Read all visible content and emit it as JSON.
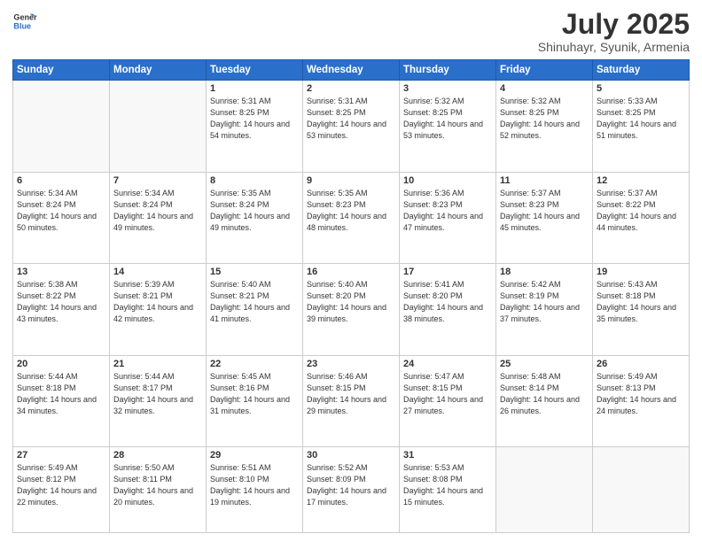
{
  "logo": {
    "line1": "General",
    "line2": "Blue"
  },
  "header": {
    "month": "July 2025",
    "location": "Shinuhayr, Syunik, Armenia"
  },
  "weekdays": [
    "Sunday",
    "Monday",
    "Tuesday",
    "Wednesday",
    "Thursday",
    "Friday",
    "Saturday"
  ],
  "weeks": [
    [
      {
        "day": "",
        "empty": true
      },
      {
        "day": "",
        "empty": true
      },
      {
        "day": "1",
        "sunrise": "Sunrise: 5:31 AM",
        "sunset": "Sunset: 8:25 PM",
        "daylight": "Daylight: 14 hours and 54 minutes."
      },
      {
        "day": "2",
        "sunrise": "Sunrise: 5:31 AM",
        "sunset": "Sunset: 8:25 PM",
        "daylight": "Daylight: 14 hours and 53 minutes."
      },
      {
        "day": "3",
        "sunrise": "Sunrise: 5:32 AM",
        "sunset": "Sunset: 8:25 PM",
        "daylight": "Daylight: 14 hours and 53 minutes."
      },
      {
        "day": "4",
        "sunrise": "Sunrise: 5:32 AM",
        "sunset": "Sunset: 8:25 PM",
        "daylight": "Daylight: 14 hours and 52 minutes."
      },
      {
        "day": "5",
        "sunrise": "Sunrise: 5:33 AM",
        "sunset": "Sunset: 8:25 PM",
        "daylight": "Daylight: 14 hours and 51 minutes."
      }
    ],
    [
      {
        "day": "6",
        "sunrise": "Sunrise: 5:34 AM",
        "sunset": "Sunset: 8:24 PM",
        "daylight": "Daylight: 14 hours and 50 minutes."
      },
      {
        "day": "7",
        "sunrise": "Sunrise: 5:34 AM",
        "sunset": "Sunset: 8:24 PM",
        "daylight": "Daylight: 14 hours and 49 minutes."
      },
      {
        "day": "8",
        "sunrise": "Sunrise: 5:35 AM",
        "sunset": "Sunset: 8:24 PM",
        "daylight": "Daylight: 14 hours and 49 minutes."
      },
      {
        "day": "9",
        "sunrise": "Sunrise: 5:35 AM",
        "sunset": "Sunset: 8:23 PM",
        "daylight": "Daylight: 14 hours and 48 minutes."
      },
      {
        "day": "10",
        "sunrise": "Sunrise: 5:36 AM",
        "sunset": "Sunset: 8:23 PM",
        "daylight": "Daylight: 14 hours and 47 minutes."
      },
      {
        "day": "11",
        "sunrise": "Sunrise: 5:37 AM",
        "sunset": "Sunset: 8:23 PM",
        "daylight": "Daylight: 14 hours and 45 minutes."
      },
      {
        "day": "12",
        "sunrise": "Sunrise: 5:37 AM",
        "sunset": "Sunset: 8:22 PM",
        "daylight": "Daylight: 14 hours and 44 minutes."
      }
    ],
    [
      {
        "day": "13",
        "sunrise": "Sunrise: 5:38 AM",
        "sunset": "Sunset: 8:22 PM",
        "daylight": "Daylight: 14 hours and 43 minutes."
      },
      {
        "day": "14",
        "sunrise": "Sunrise: 5:39 AM",
        "sunset": "Sunset: 8:21 PM",
        "daylight": "Daylight: 14 hours and 42 minutes."
      },
      {
        "day": "15",
        "sunrise": "Sunrise: 5:40 AM",
        "sunset": "Sunset: 8:21 PM",
        "daylight": "Daylight: 14 hours and 41 minutes."
      },
      {
        "day": "16",
        "sunrise": "Sunrise: 5:40 AM",
        "sunset": "Sunset: 8:20 PM",
        "daylight": "Daylight: 14 hours and 39 minutes."
      },
      {
        "day": "17",
        "sunrise": "Sunrise: 5:41 AM",
        "sunset": "Sunset: 8:20 PM",
        "daylight": "Daylight: 14 hours and 38 minutes."
      },
      {
        "day": "18",
        "sunrise": "Sunrise: 5:42 AM",
        "sunset": "Sunset: 8:19 PM",
        "daylight": "Daylight: 14 hours and 37 minutes."
      },
      {
        "day": "19",
        "sunrise": "Sunrise: 5:43 AM",
        "sunset": "Sunset: 8:18 PM",
        "daylight": "Daylight: 14 hours and 35 minutes."
      }
    ],
    [
      {
        "day": "20",
        "sunrise": "Sunrise: 5:44 AM",
        "sunset": "Sunset: 8:18 PM",
        "daylight": "Daylight: 14 hours and 34 minutes."
      },
      {
        "day": "21",
        "sunrise": "Sunrise: 5:44 AM",
        "sunset": "Sunset: 8:17 PM",
        "daylight": "Daylight: 14 hours and 32 minutes."
      },
      {
        "day": "22",
        "sunrise": "Sunrise: 5:45 AM",
        "sunset": "Sunset: 8:16 PM",
        "daylight": "Daylight: 14 hours and 31 minutes."
      },
      {
        "day": "23",
        "sunrise": "Sunrise: 5:46 AM",
        "sunset": "Sunset: 8:15 PM",
        "daylight": "Daylight: 14 hours and 29 minutes."
      },
      {
        "day": "24",
        "sunrise": "Sunrise: 5:47 AM",
        "sunset": "Sunset: 8:15 PM",
        "daylight": "Daylight: 14 hours and 27 minutes."
      },
      {
        "day": "25",
        "sunrise": "Sunrise: 5:48 AM",
        "sunset": "Sunset: 8:14 PM",
        "daylight": "Daylight: 14 hours and 26 minutes."
      },
      {
        "day": "26",
        "sunrise": "Sunrise: 5:49 AM",
        "sunset": "Sunset: 8:13 PM",
        "daylight": "Daylight: 14 hours and 24 minutes."
      }
    ],
    [
      {
        "day": "27",
        "sunrise": "Sunrise: 5:49 AM",
        "sunset": "Sunset: 8:12 PM",
        "daylight": "Daylight: 14 hours and 22 minutes."
      },
      {
        "day": "28",
        "sunrise": "Sunrise: 5:50 AM",
        "sunset": "Sunset: 8:11 PM",
        "daylight": "Daylight: 14 hours and 20 minutes."
      },
      {
        "day": "29",
        "sunrise": "Sunrise: 5:51 AM",
        "sunset": "Sunset: 8:10 PM",
        "daylight": "Daylight: 14 hours and 19 minutes."
      },
      {
        "day": "30",
        "sunrise": "Sunrise: 5:52 AM",
        "sunset": "Sunset: 8:09 PM",
        "daylight": "Daylight: 14 hours and 17 minutes."
      },
      {
        "day": "31",
        "sunrise": "Sunrise: 5:53 AM",
        "sunset": "Sunset: 8:08 PM",
        "daylight": "Daylight: 14 hours and 15 minutes."
      },
      {
        "day": "",
        "empty": true
      },
      {
        "day": "",
        "empty": true
      }
    ]
  ]
}
